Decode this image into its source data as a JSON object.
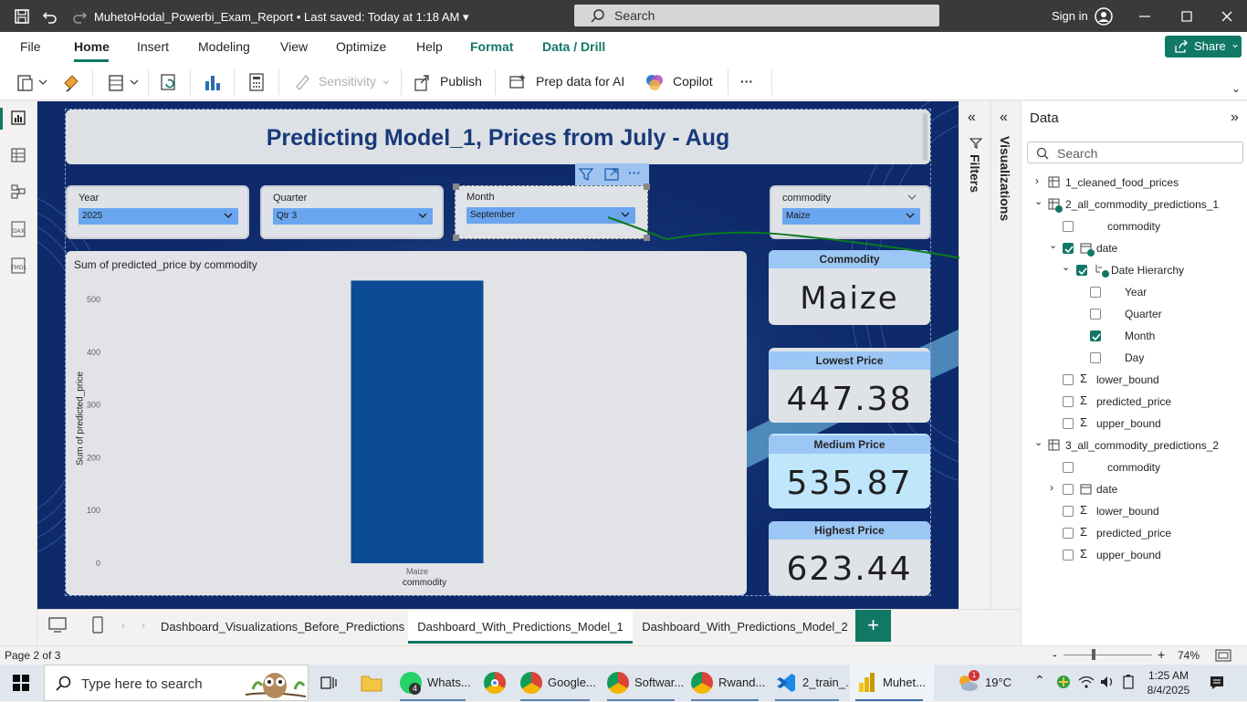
{
  "app": {
    "title": "MuhetoHodal_Powerbi_Exam_Report • Last saved: Today at 1:18 AM",
    "search_placeholder": "Search",
    "sign_in": "Sign in"
  },
  "ribbon": {
    "tabs": [
      "File",
      "Home",
      "Insert",
      "Modeling",
      "View",
      "Optimize",
      "Help",
      "Format",
      "Data / Drill"
    ],
    "active_tab": "Home",
    "share": "Share",
    "sensitivity": "Sensitivity",
    "publish": "Publish",
    "prep_ai": "Prep data for AI",
    "copilot": "Copilot",
    "more": "···"
  },
  "report": {
    "title": "Predicting Model_1, Prices from July - Aug",
    "slicers": [
      {
        "label": "Year",
        "value": "2025"
      },
      {
        "label": "Quarter",
        "value": "Qtr 3"
      },
      {
        "label": "Month",
        "value": "September"
      },
      {
        "label": "commodity",
        "value": "Maize"
      }
    ],
    "chart_title": "Sum of predicted_price by commodity",
    "kpis": [
      {
        "label": "Commodity",
        "value": "Maize"
      },
      {
        "label": "Lowest Price",
        "value": "447.38"
      },
      {
        "label": "Medium Price",
        "value": "535.87"
      },
      {
        "label": "Highest Price",
        "value": "623.44"
      }
    ]
  },
  "chart_data": {
    "type": "bar",
    "title": "Sum of predicted_price by commodity",
    "categories": [
      "Maize"
    ],
    "values": [
      535.87
    ],
    "xlabel": "commodity",
    "ylabel": "Sum of predicted_price",
    "yticks": [
      "0",
      "100",
      "200",
      "300",
      "400",
      "500"
    ],
    "ylim": [
      0,
      540
    ],
    "bar_color": "#0b4a94"
  },
  "panes": {
    "filters": "Filters",
    "visualizations": "Visualizations",
    "data_title": "Data",
    "data_search": "Search"
  },
  "fields": [
    {
      "label": "1_cleaned_food_prices"
    },
    {
      "label": "2_all_commodity_predictions_1"
    },
    {
      "label": "commodity"
    },
    {
      "label": "date"
    },
    {
      "label": "Date Hierarchy"
    },
    {
      "label": "Year"
    },
    {
      "label": "Quarter"
    },
    {
      "label": "Month"
    },
    {
      "label": "Day"
    },
    {
      "label": "lower_bound",
      "sigma": "Σ"
    },
    {
      "label": "predicted_price",
      "sigma": "Σ"
    },
    {
      "label": "upper_bound",
      "sigma": "Σ"
    },
    {
      "label": "3_all_commodity_predictions_2"
    },
    {
      "label": "commodity"
    },
    {
      "label": "date"
    },
    {
      "label": "lower_bound",
      "sigma": "Σ"
    },
    {
      "label": "predicted_price",
      "sigma": "Σ"
    },
    {
      "label": "upper_bound",
      "sigma": "Σ"
    }
  ],
  "pages": [
    "Dashboard_Visualizations_Before_Predictions",
    "Dashboard_With_Predictions_Model_1",
    "Dashboard_With_Predictions_Model_2"
  ],
  "add_page": "+",
  "status": {
    "page": "Page 2 of 3",
    "zoom_minus": "-",
    "zoom_plus": "+",
    "zoom": "74%"
  },
  "taskbar": {
    "search": "Type here to search",
    "apps": [
      "Whats...",
      "Google...",
      "Softwar...",
      "Rwand...",
      "2_train_...",
      "Muhet..."
    ],
    "whatsapp_badge": "4",
    "weather_badge": "1",
    "temperature": "19°C",
    "time": "1:25 AM",
    "date": "8/4/2025"
  }
}
